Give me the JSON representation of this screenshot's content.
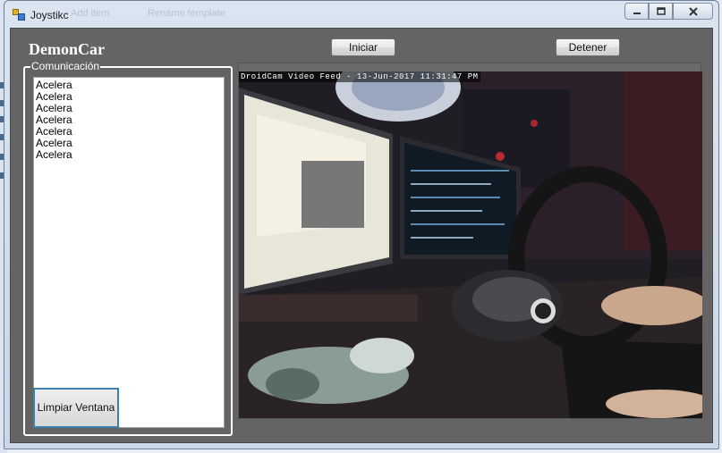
{
  "window": {
    "title": "Joystikc",
    "ghost_items": [
      "Add item",
      "Rename template"
    ]
  },
  "header": {
    "brand": "DemonCar",
    "start_label": "Iniciar",
    "stop_label": "Detener"
  },
  "communication": {
    "group_title": "Comunicación",
    "log_items": [
      "Acelera",
      "Acelera",
      "Acelera",
      "Acelera",
      "Acelera",
      "Acelera",
      "Acelera"
    ],
    "clear_label": "Limpiar Ventana"
  },
  "video": {
    "overlay": "DroidCam Video Feed - 13-Jun-2017 11:31:47 PM"
  },
  "colors": {
    "client_bg": "#646464",
    "selection_border": "#3c7fb1"
  },
  "icons": {
    "app": "app-window-icon",
    "minimize": "minimize-icon",
    "maximize": "maximize-icon",
    "close": "close-icon"
  }
}
